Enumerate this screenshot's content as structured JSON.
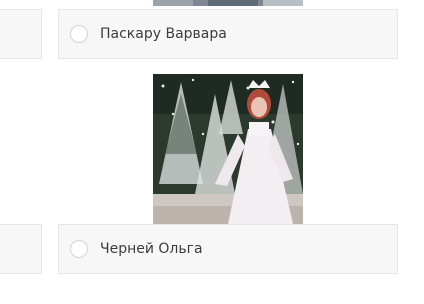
{
  "options": [
    {
      "name": "Паскару Варвара",
      "selected": false
    },
    {
      "name": "Черней Ольга",
      "selected": false
    }
  ],
  "photos": [
    {
      "subject": "partial-photo"
    },
    {
      "subject": "girl-in-white-snow-maiden-costume"
    }
  ]
}
